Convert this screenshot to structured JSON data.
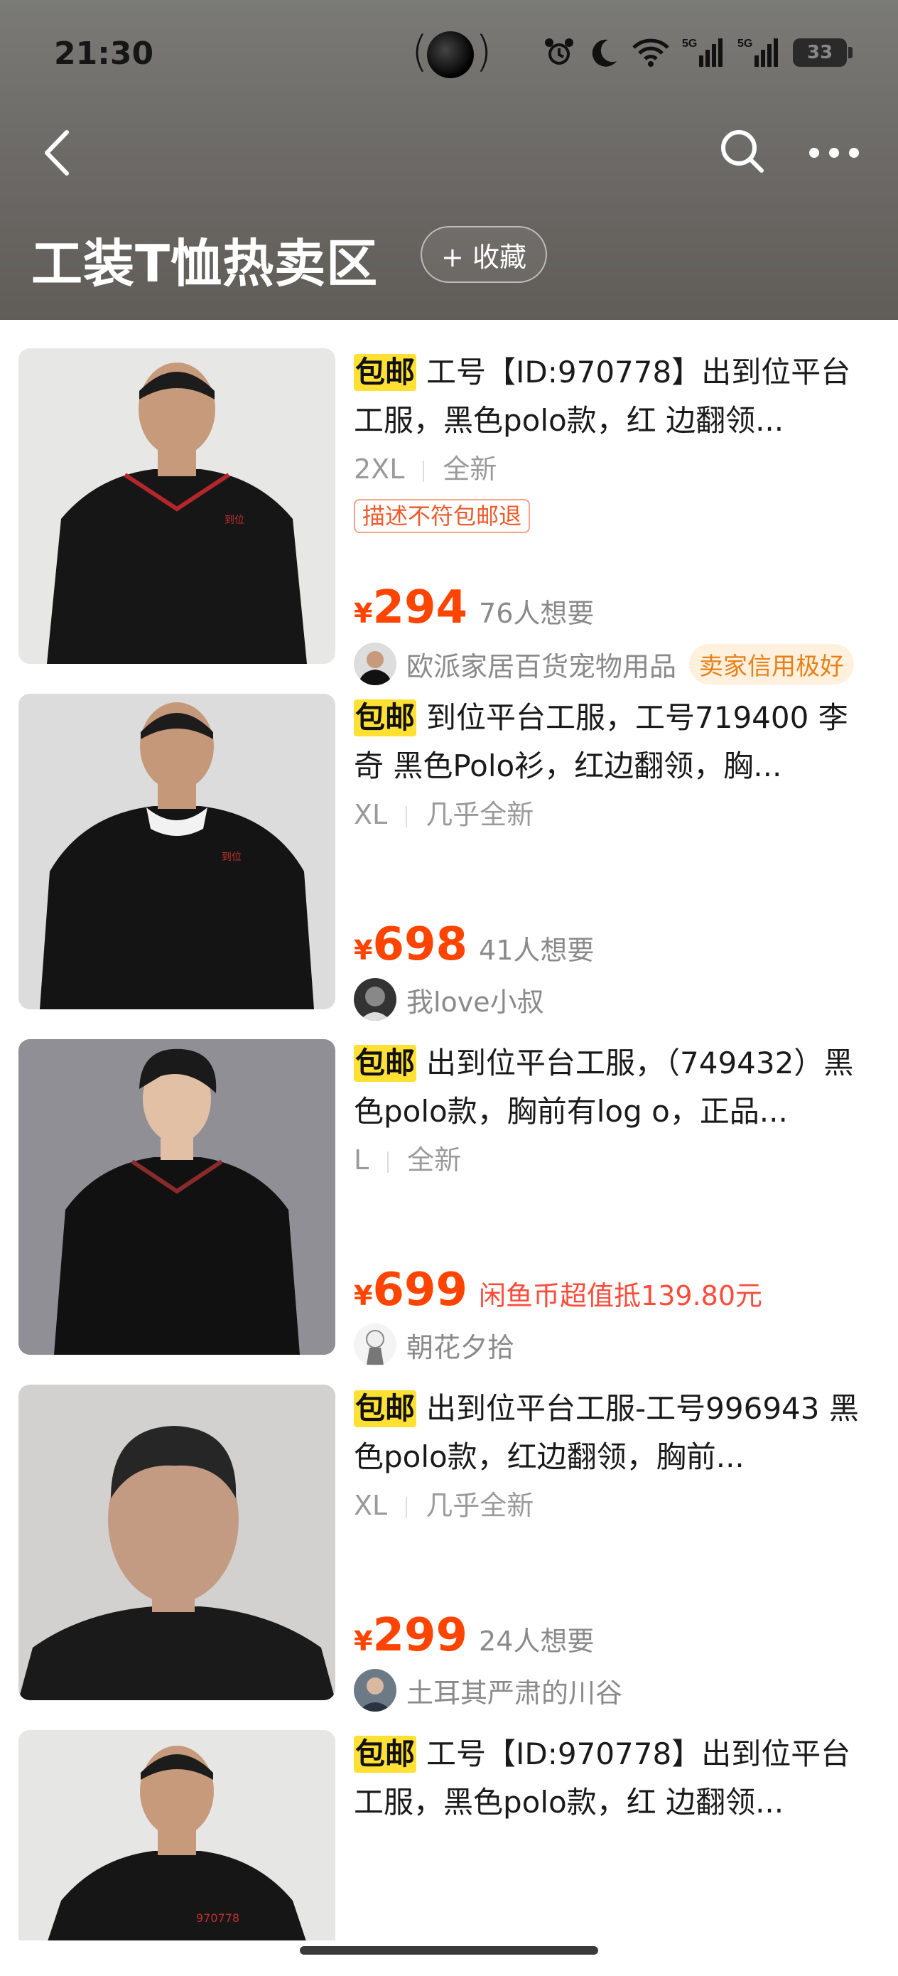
{
  "status_bar": {
    "time": "21:30",
    "battery": "33",
    "network": [
      "5G",
      "5G"
    ]
  },
  "header": {
    "title": "工装T恤热卖区",
    "favorite_label": "+ 收藏"
  },
  "items": [
    {
      "ship_tag": "包邮",
      "title": "工号【ID:970778】出到位平台工服，黑色polo款，红 边翻领...",
      "size": "2XL",
      "condition": "全新",
      "promo": "描述不符包邮退",
      "price": "294",
      "wants": "76人想要",
      "seller": "欧派家居百货宠物用品",
      "credit": "卖家信用极好"
    },
    {
      "ship_tag": "包邮",
      "title": "到位平台工服，工号719400 李奇 黑色Polo衫，红边翻领，胸...",
      "size": "XL",
      "condition": "几乎全新",
      "price": "698",
      "wants": "41人想要",
      "seller": "我love小叔"
    },
    {
      "ship_tag": "包邮",
      "title": "出到位平台工服，（749432）黑色polo款，胸前有log o，正品...",
      "size": "L",
      "condition": "全新",
      "price": "699",
      "coin_note": "闲鱼币超值抵139.80元",
      "seller": "朝花夕拾"
    },
    {
      "ship_tag": "包邮",
      "title": "出到位平台工服-工号996943 黑色polo款，红边翻领，胸前...",
      "size": "XL",
      "condition": "几乎全新",
      "price": "299",
      "wants": "24人想要",
      "seller": "土耳其严肃的川谷"
    },
    {
      "ship_tag": "包邮",
      "title": "工号【ID:970778】出到位平台工服，黑色polo款，红 边翻领...",
      "shirt_text": "970778"
    }
  ],
  "currency_symbol": "¥",
  "colors": {
    "accent": "#ff4400",
    "ship_tag_bg": "#ffe033",
    "credit_text": "#e88018"
  },
  "icons": [
    "back-icon",
    "search-icon",
    "more-icon",
    "alarm-icon",
    "moon-icon",
    "wifi-icon",
    "signal-icon",
    "battery-icon"
  ]
}
